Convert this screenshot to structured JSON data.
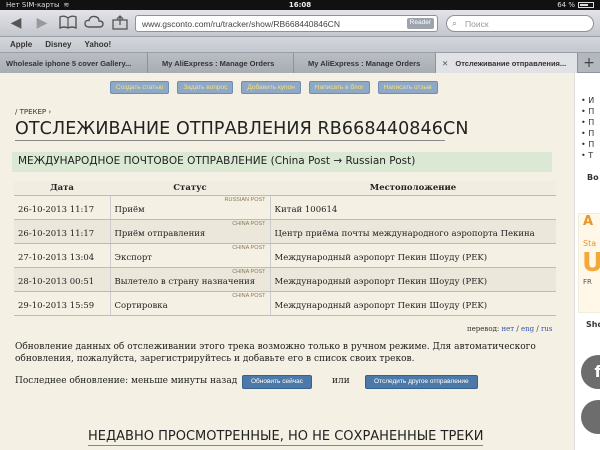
{
  "statusbar": {
    "carrier": "Нет SIM-карты",
    "time": "16:08",
    "battery": "64 %"
  },
  "browser": {
    "url": "www.gsconto.com/ru/tracker/show/RB668440846CN",
    "reader": "Reader",
    "search_placeholder": "Поиск",
    "bookmarks": [
      "Apple",
      "Disney",
      "Yahoo!"
    ],
    "tabs": [
      {
        "label": "Wholesale iphone 5 cover Gallery..."
      },
      {
        "label": "My AliExpress : Manage Orders"
      },
      {
        "label": "My AliExpress : Manage Orders"
      },
      {
        "label": "Отслеживание отправления...",
        "close": "✕"
      }
    ],
    "add_tab": "+"
  },
  "page": {
    "top_buttons": [
      "Создать статью",
      "Задать вопрос",
      "Добавить купон",
      "Написать в блог",
      "Написать отзыв"
    ],
    "breadcrumb": "/ ТРЕКЕР ›",
    "title": "ОТСЛЕЖИВАНИЕ ОТПРАВЛЕНИЯ RB668440846CN",
    "shipment_banner": "МЕЖДУНАРОДНОЕ ПОЧТОВОЕ ОТПРАВЛЕНИЕ (China Post →  Russian Post)",
    "table": {
      "headers": [
        "Дата",
        "Статус",
        "Местоположение"
      ],
      "rows": [
        {
          "date": "26-10-2013 11:17",
          "carrier": "RUSSIAN POST",
          "status": "Приём",
          "location": "Китай 100614"
        },
        {
          "date": "26-10-2013 11:17",
          "carrier": "CHINA POST",
          "status": "Приём отправления",
          "location": "Центр приёма почты международного аэропорта Пекина"
        },
        {
          "date": "27-10-2013 13:04",
          "carrier": "CHINA POST",
          "status": "Экспорт",
          "location": "Международный аэропорт Пекин Шоуду (PEK)"
        },
        {
          "date": "28-10-2013 00:51",
          "carrier": "CHINA POST",
          "status": "Вылетело в страну назначения",
          "location": "Международный аэропорт Пекин Шоуду (PEK)"
        },
        {
          "date": "29-10-2013 15:59",
          "carrier": "CHINA POST",
          "status": "Сортировка",
          "location": "Международный аэропорт Пекин Шоуду (PEK)"
        }
      ]
    },
    "translation": {
      "label": "перевод:",
      "options": [
        "нет",
        "eng",
        "rus"
      ],
      "sep": "/"
    },
    "notice": "Обновление данных об отслеживании этого трека возможно только в ручном режиме. Для автоматического обновления, пожалуйста, зарегистрируйтесь и добавьте его в список своих треков.",
    "last_update": "Последнее обновление: меньше минуты назад",
    "update_button": "Обновить сейчас",
    "or_text": "или",
    "track_other_button": "Отследить другое отправление",
    "recent_heading": "НЕДАВНО ПРОСМОТРЕННЫЕ, НО НЕ СОХРАНЕННЫЕ ТРЕКИ"
  },
  "sidebar": {
    "items": [
      "И",
      "П",
      "П",
      "П",
      "П",
      "Т"
    ],
    "bo": "Во",
    "ad": {
      "line1": "A",
      "line2": "Sta",
      "line3": "U",
      "line4": "FR"
    },
    "sho": "Sho",
    "fb": "f"
  }
}
